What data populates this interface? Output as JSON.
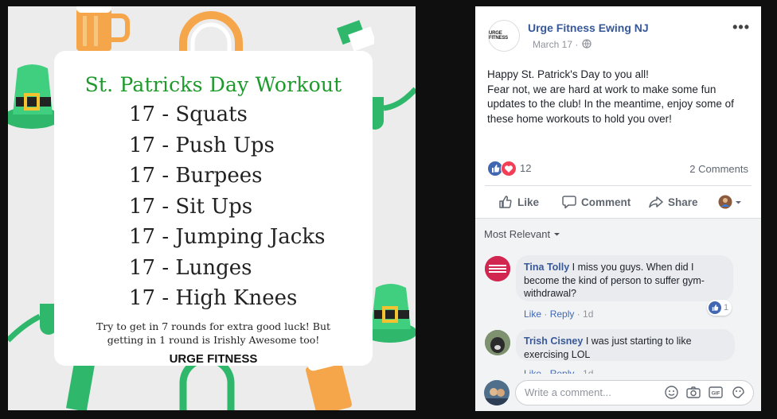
{
  "photo": {
    "title": "St. Patricks Day Workout",
    "exercises": [
      "17 - Squats",
      "17 - Push Ups",
      "17 - Burpees",
      "17 - Sit Ups",
      "17 - Jumping Jacks",
      "17 - Lunges",
      "17 - High Knees"
    ],
    "note": "Try to get in 7 rounds for extra good luck! But getting in 1 round is Irishly Awesome too!",
    "brand": "URGE FITNESS"
  },
  "post": {
    "page_name": "Urge Fitness Ewing NJ",
    "avatar_text": "URGE FITNESS",
    "date": "March 17 ·",
    "text_line1": "Happy St. Patrick's Day to you all!",
    "text_line2": "Fear not, we are hard at work to make some fun updates to the club! In the meantime, enjoy some of these home workouts to hold you over!",
    "reaction_count": "12",
    "comment_count": "2 Comments",
    "actions": {
      "like": "Like",
      "comment": "Comment",
      "share": "Share"
    }
  },
  "comments": {
    "sort_label": "Most Relevant",
    "items": [
      {
        "author": "Tina Tolly",
        "text": "I miss you guys. When did I become the kind of person to suffer gym-withdrawal?",
        "like": "Like",
        "reply": "Reply",
        "time": "1d",
        "reaction_count": "1"
      },
      {
        "author": "Trish Cisney",
        "text": "I was just starting to like exercising LOL",
        "like": "Like",
        "reply": "Reply",
        "time": "1d"
      }
    ],
    "composer_placeholder": "Write a comment..."
  },
  "colors": {
    "facebook_link": "#365899",
    "title_green": "#1d9a2b",
    "like_blue": "#4267b2",
    "love_red": "#f33e58"
  },
  "icons": [
    "globe-icon",
    "more-icon",
    "like-icon",
    "love-icon",
    "comment-icon",
    "share-icon",
    "emoji-icon",
    "camera-icon",
    "gif-icon",
    "sticker-icon",
    "caret-down-icon"
  ]
}
